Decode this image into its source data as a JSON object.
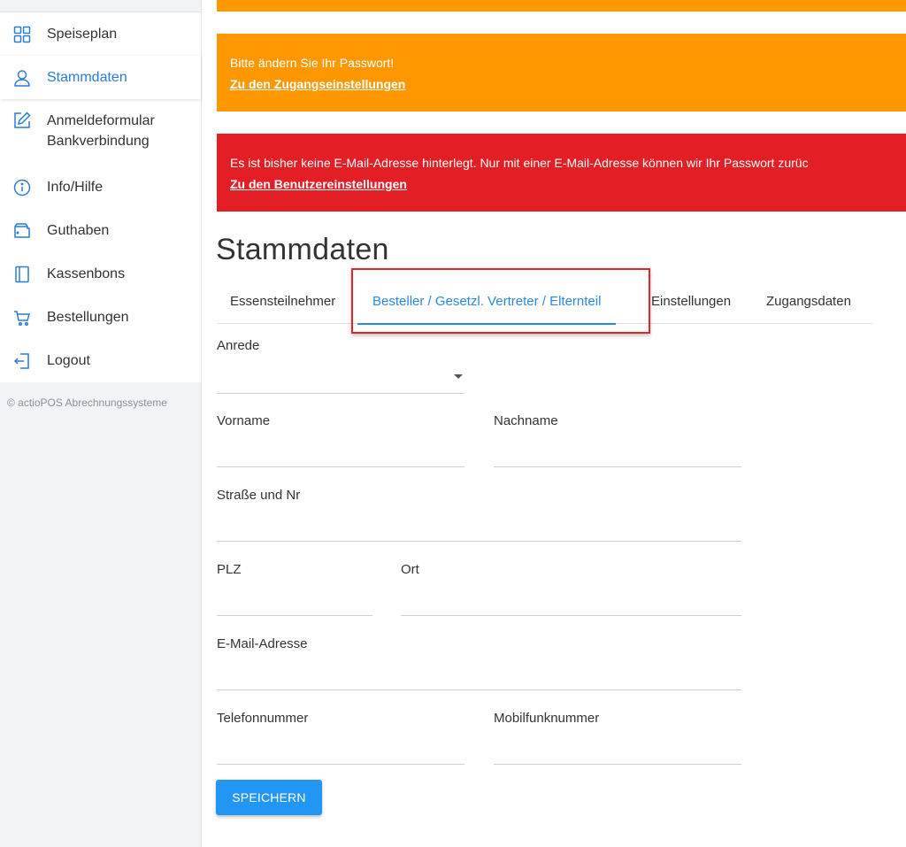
{
  "sidebar": {
    "items": [
      {
        "label": "Speiseplan",
        "icon": "grid-icon"
      },
      {
        "label": "Stammdaten",
        "icon": "user-icon"
      },
      {
        "label": "Anmeldeformular",
        "label2": "Bankverbindung",
        "icon": "edit-icon"
      },
      {
        "label": "Info/Hilfe",
        "icon": "info-icon"
      },
      {
        "label": "Guthaben",
        "icon": "wallet-icon"
      },
      {
        "label": "Kassenbons",
        "icon": "notebook-icon"
      },
      {
        "label": "Bestellungen",
        "icon": "cart-icon"
      },
      {
        "label": "Logout",
        "icon": "logout-icon"
      }
    ],
    "active_index": 1,
    "copyright": "© actioPOS Abrechnungssysteme"
  },
  "alerts": {
    "password": {
      "text": "Bitte ändern Sie Ihr Passwort!",
      "link": "Zu den Zugangseinstellungen",
      "color": "#ff9800"
    },
    "email": {
      "text": "Es ist bisher keine E-Mail-Adresse hinterlegt. Nur mit einer E-Mail-Adresse können wir Ihr Passwort zurüc",
      "link": "Zu den Benutzereinstellungen",
      "color": "#e31e24"
    }
  },
  "page": {
    "title": "Stammdaten"
  },
  "tabs": [
    {
      "label": "Essensteilnehmer"
    },
    {
      "label": "Besteller / Gesetzl. Vertreter / Elternteil"
    },
    {
      "label": "Einstellungen"
    },
    {
      "label": "Zugangsdaten"
    }
  ],
  "active_tab": 1,
  "form": {
    "anrede": {
      "label": "Anrede",
      "value": ""
    },
    "vorname": {
      "label": "Vorname",
      "value": ""
    },
    "nachname": {
      "label": "Nachname",
      "value": ""
    },
    "strasse": {
      "label": "Straße und Nr",
      "value": ""
    },
    "plz": {
      "label": "PLZ",
      "value": ""
    },
    "ort": {
      "label": "Ort",
      "value": ""
    },
    "email": {
      "label": "E-Mail-Adresse",
      "value": ""
    },
    "telefon": {
      "label": "Telefonnummer",
      "value": ""
    },
    "mobil": {
      "label": "Mobilfunknummer",
      "value": ""
    }
  },
  "save_label": "Speichern",
  "colors": {
    "accent": "#2a7dd6",
    "tab_active": "#2a8ae0",
    "button": "#2196f3",
    "highlight": "#e0262b"
  }
}
